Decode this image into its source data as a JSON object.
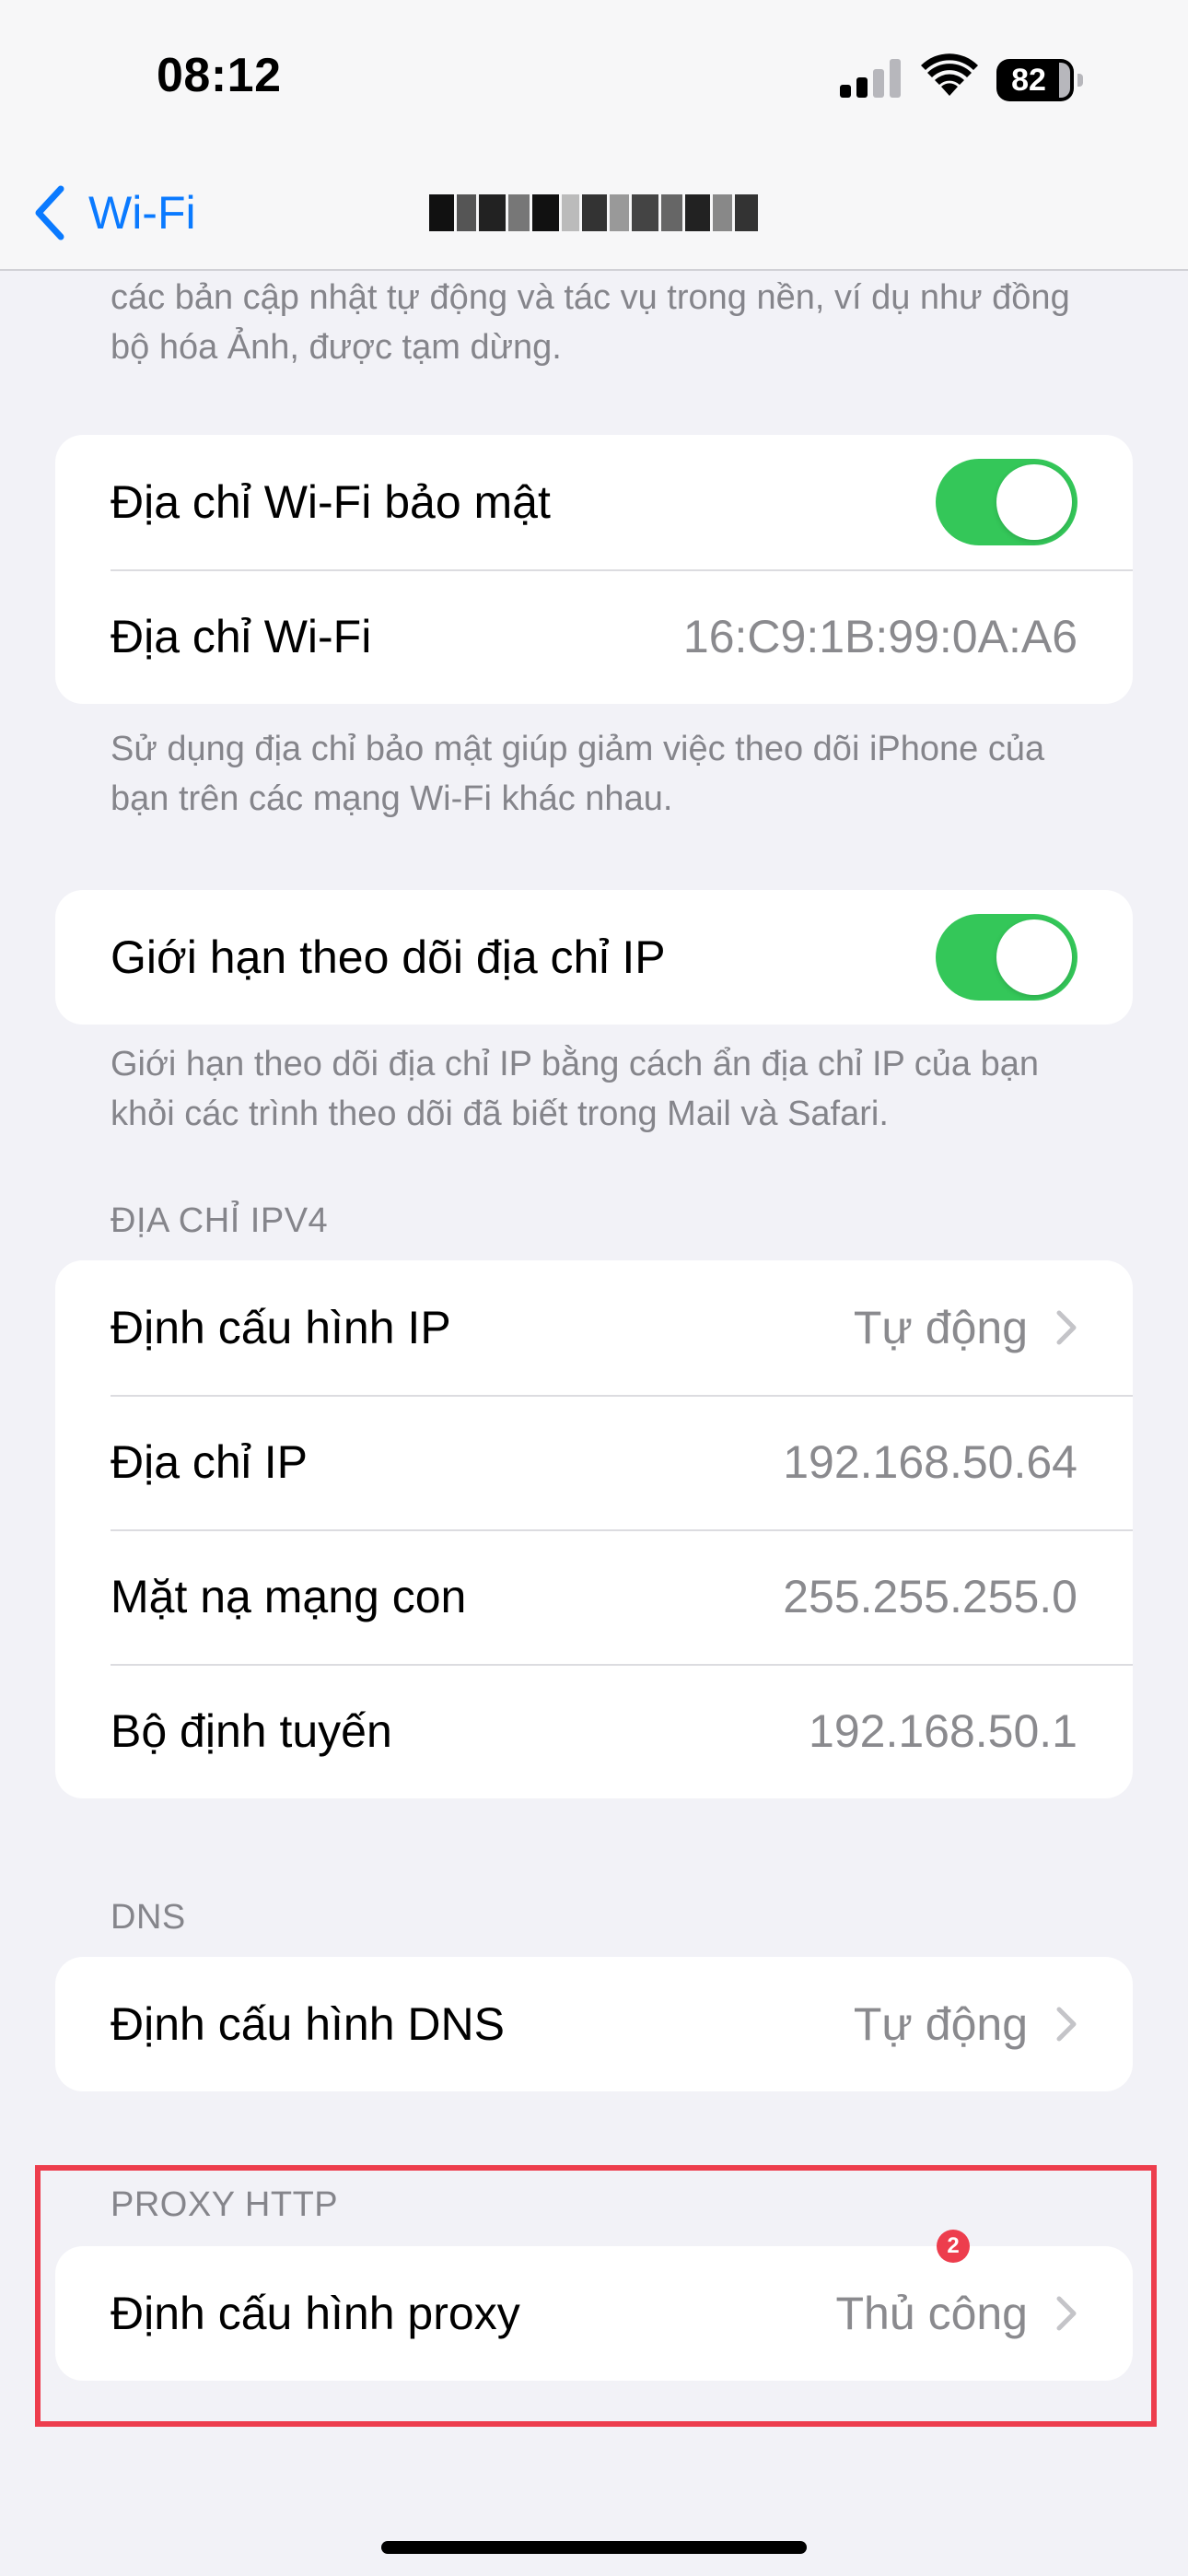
{
  "status_bar": {
    "time": "08:12",
    "battery_percent": "82",
    "signal_bars_filled": 2,
    "signal_bars_total": 4,
    "wifi_icon": "wifi-icon"
  },
  "nav": {
    "back_label": "Wi-Fi",
    "back_icon": "chevron-left-icon",
    "title_obscured": true
  },
  "top_footer": "các bản cập nhật tự động và tác vụ trong nền, ví dụ như đồng bộ hóa Ảnh, được tạm dừng.",
  "private_address": {
    "rows": [
      {
        "label": "Địa chỉ Wi-Fi bảo mật",
        "toggle_on": true
      },
      {
        "label": "Địa chỉ Wi-Fi",
        "value": "16:C9:1B:99:0A:A6"
      }
    ],
    "footer": "Sử dụng địa chỉ bảo mật giúp giảm việc theo dõi iPhone của bạn trên các mạng Wi-Fi khác nhau."
  },
  "limit_ip": {
    "label": "Giới hạn theo dõi địa chỉ IP",
    "toggle_on": true,
    "footer": "Giới hạn theo dõi địa chỉ IP bằng cách ẩn địa chỉ IP của bạn khỏi các trình theo dõi đã biết trong Mail và Safari."
  },
  "ipv4": {
    "header": "ĐỊA CHỈ IPV4",
    "rows": [
      {
        "label": "Định cấu hình IP",
        "value": "Tự động",
        "chevron": true
      },
      {
        "label": "Địa chỉ IP",
        "value": "192.168.50.64"
      },
      {
        "label": "Mặt nạ mạng con",
        "value": "255.255.255.0"
      },
      {
        "label": "Bộ định tuyến",
        "value": "192.168.50.1"
      }
    ]
  },
  "dns": {
    "header": "DNS",
    "label": "Định cấu hình DNS",
    "value": "Tự động"
  },
  "proxy": {
    "header": "PROXY HTTP",
    "label": "Định cấu hình proxy",
    "value": "Thủ công",
    "badge": "2",
    "highlight_color": "#ed3d4d"
  },
  "colors": {
    "accent": "#0a7aff",
    "toggle_on": "#34c759",
    "background": "#f2f2f7"
  }
}
